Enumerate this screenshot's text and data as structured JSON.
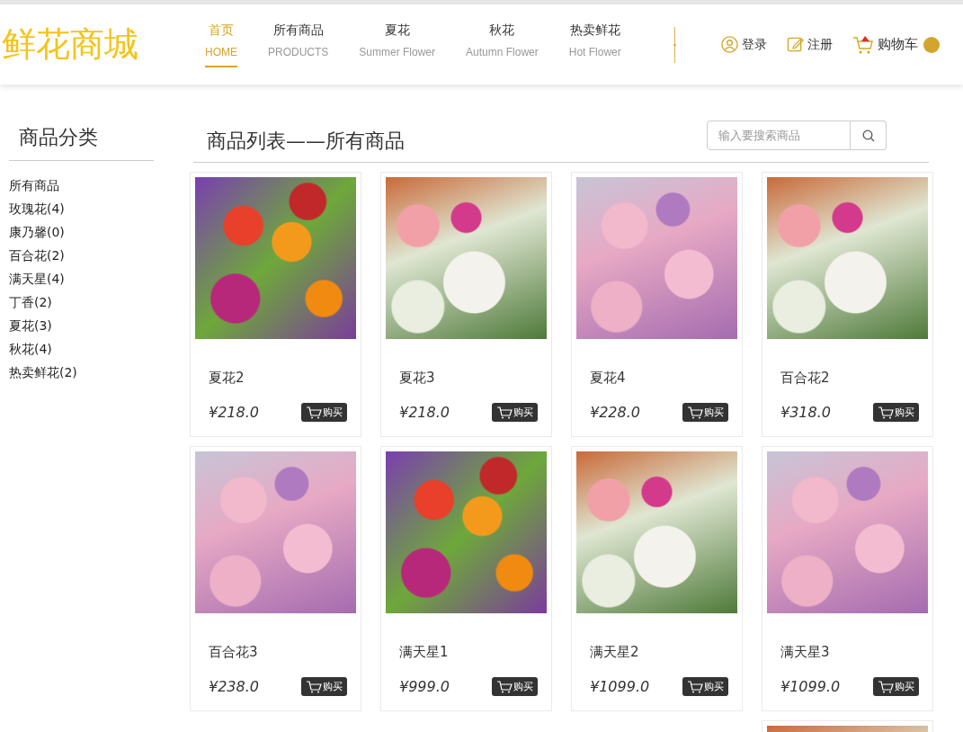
{
  "header": {
    "logo": "鲜花商城",
    "nav": [
      {
        "label": "首页",
        "sublabel": "HOME",
        "selected": true
      },
      {
        "label": "所有商品",
        "sublabel": "PRODUCTS",
        "selected": false
      },
      {
        "label": "夏花",
        "sublabel": "Summer Flower",
        "selected": false
      },
      {
        "label": "秋花",
        "sublabel": "Autumn Flower",
        "selected": false
      },
      {
        "label": "热卖鲜花",
        "sublabel": "Hot Flower",
        "selected": false
      }
    ],
    "login": "登录",
    "register": "注册",
    "cart": "购物车"
  },
  "sidebar": {
    "title": "商品分类",
    "items": [
      "所有商品",
      "玫瑰花(4)",
      "康乃馨(0)",
      "百合花(2)",
      "满天星(4)",
      "丁香(2)",
      "夏花(3)",
      "秋花(4)",
      "热卖鲜花(2)"
    ]
  },
  "main": {
    "title": "商品列表——所有商品",
    "search": {
      "placeholder": "输入要搜索商品"
    },
    "products": [
      {
        "kind": "mixed",
        "name": "夏花2",
        "price": "¥218.0",
        "buy": "购买"
      },
      {
        "kind": "lily",
        "name": "夏花3",
        "price": "¥218.0",
        "buy": "购买"
      },
      {
        "kind": "rose",
        "name": "夏花4",
        "price": "¥228.0",
        "buy": "购买"
      },
      {
        "kind": "lily",
        "name": "百合花2",
        "price": "¥318.0",
        "buy": "购买"
      },
      {
        "kind": "rose",
        "name": "百合花3",
        "price": "¥238.0",
        "buy": "购买"
      },
      {
        "kind": "mixed",
        "name": "满天星1",
        "price": "¥999.0",
        "buy": "购买"
      },
      {
        "kind": "lily",
        "name": "满天星2",
        "price": "¥1099.0",
        "buy": "购买"
      },
      {
        "kind": "rose",
        "name": "满天星3",
        "price": "¥1099.0",
        "buy": "购买"
      },
      {
        "kind": "lily"
      }
    ]
  }
}
